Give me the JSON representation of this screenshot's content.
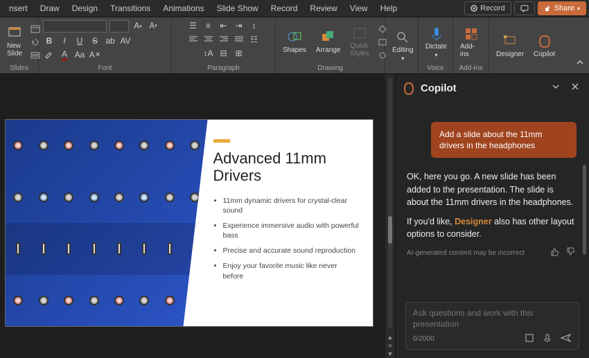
{
  "menu": {
    "items": [
      "nsert",
      "Draw",
      "Design",
      "Transitions",
      "Animations",
      "Slide Show",
      "Record",
      "Review",
      "View",
      "Help"
    ],
    "record_btn": "Record",
    "share_btn": "Share"
  },
  "ribbon": {
    "slides": {
      "new_slide": "New\nSlide",
      "label": "Slides"
    },
    "font": {
      "label": "Font"
    },
    "paragraph": {
      "label": "Paragraph"
    },
    "drawing": {
      "shapes": "Shapes",
      "arrange": "Arrange",
      "quick": "Quick\nStyles",
      "label": "Drawing"
    },
    "editing": {
      "btn": "Editing"
    },
    "voice": {
      "btn": "Dictate",
      "label": "Voice"
    },
    "addins": {
      "btn": "Add-ins",
      "label": "Add-ins"
    },
    "designer": {
      "btn": "Designer"
    },
    "copilot": {
      "btn": "Copilot"
    }
  },
  "slide": {
    "title": "Advanced 11mm Drivers",
    "bullets": [
      "11mm dynamic drivers for crystal-clear sound",
      "Experience immersive audio with powerful bass",
      "Precise and accurate sound reproduction",
      "Enjoy your favorite music like never before"
    ]
  },
  "copilot": {
    "title": "Copilot",
    "user_msg": "Add a slide about the 11mm drivers in the headphones",
    "assist_p1": "OK, here you go. A new slide has been added to the presentation. The slide is about the 11mm drivers in the headphones.",
    "assist_p2a": "If you'd like, ",
    "assist_designer": "Designer",
    "assist_p2b": " also has other layout options to consider.",
    "disclaimer": "AI-generated content may be incorrect",
    "placeholder": "Ask questions and work with this presentation",
    "counter": "0/2000"
  }
}
